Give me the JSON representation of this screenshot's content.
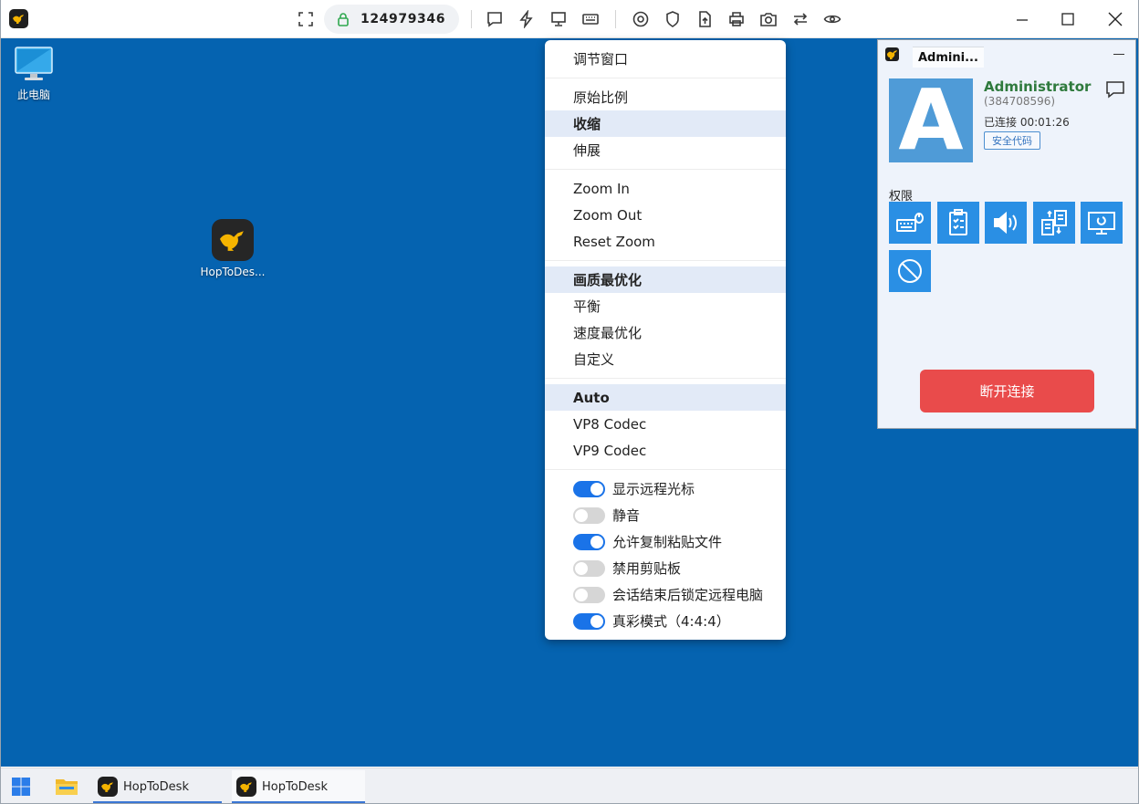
{
  "toolbar": {
    "session_id": "124979346",
    "icons": [
      "fullscreen-icon",
      "lock-icon",
      "chat-icon",
      "lightning-icon",
      "display-icon",
      "keyboard-icon",
      "target-icon",
      "shield-icon",
      "file-upload-icon",
      "print-icon",
      "camera-icon",
      "switch-icon",
      "eye-icon"
    ],
    "window_controls": [
      "minimize-icon",
      "maximize-icon",
      "close-icon"
    ]
  },
  "desktop": {
    "icons": [
      {
        "label": "此电脑",
        "icon": "computer-icon"
      },
      {
        "label": "HopToDes...",
        "icon": "hoptodesk-icon"
      }
    ]
  },
  "menu": {
    "adjust_window": "调节窗口",
    "original_ratio": "原始比例",
    "shrink": "收缩",
    "stretch": "伸展",
    "zoom_in": "Zoom In",
    "zoom_out": "Zoom Out",
    "reset_zoom": "Reset Zoom",
    "quality_best": "画质最优化",
    "balanced": "平衡",
    "speed_best": "速度最优化",
    "custom": "自定义",
    "codec_auto": "Auto",
    "codec_vp8": "VP8 Codec",
    "codec_vp9": "VP9 Codec",
    "toggles": [
      {
        "label": "显示远程光标",
        "on": true
      },
      {
        "label": "静音",
        "on": false
      },
      {
        "label": "允许复制粘贴文件",
        "on": true
      },
      {
        "label": "禁用剪贴板",
        "on": false
      },
      {
        "label": "会话结束后锁定远程电脑",
        "on": false
      },
      {
        "label": "真彩模式（4:4:4）",
        "on": true
      }
    ]
  },
  "panel": {
    "tab_label": "Admini...",
    "avatar_letter": "A",
    "name": "Administrator",
    "id": "(384708596)",
    "status": "已连接 00:01:26",
    "security_code": "安全代码",
    "permissions_label": "权限",
    "permission_icons": [
      "keyboard-mouse-icon",
      "clipboard-icon",
      "audio-icon",
      "file-transfer-icon",
      "remote-restart-icon",
      "block-icon"
    ],
    "disconnect": "断开连接"
  },
  "taskbar": {
    "items": [
      {
        "label": "HopToDesk"
      },
      {
        "label": "HopToDesk"
      }
    ]
  },
  "colors": {
    "desktop_bg": "#0563b0",
    "accent_blue": "#1a73e8",
    "permission_blue": "#2a8fe4",
    "disconnect_red": "#e94b4b",
    "name_green": "#2f7a3d"
  }
}
